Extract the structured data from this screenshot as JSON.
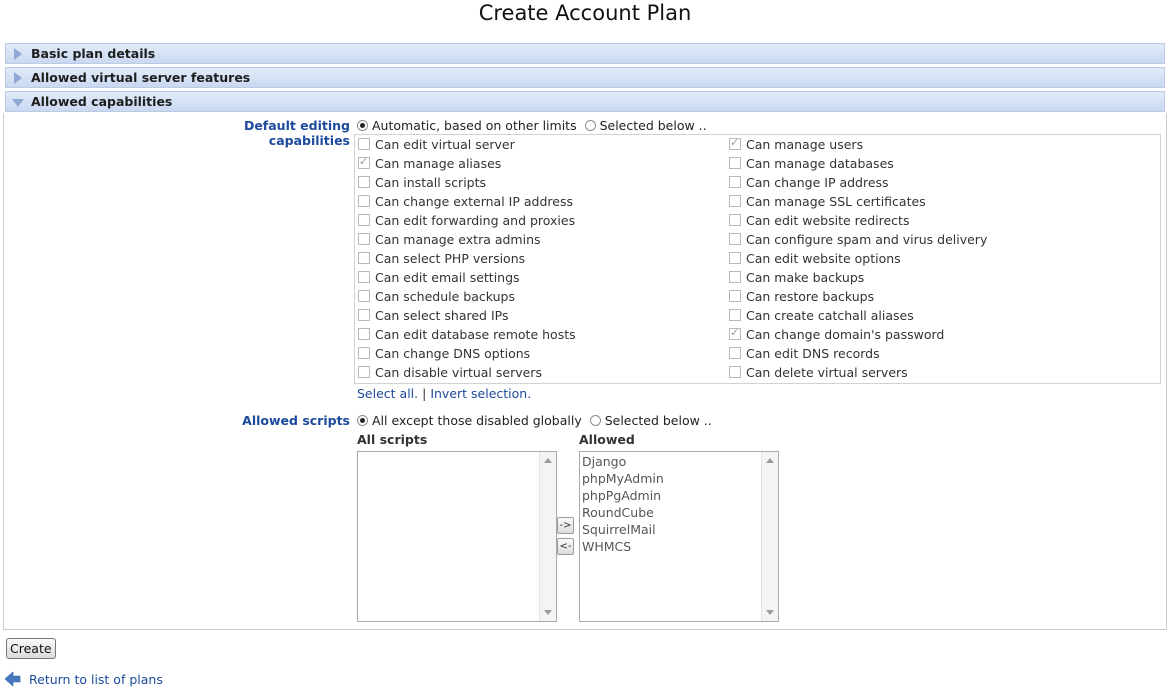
{
  "page": {
    "title": "Create Account Plan"
  },
  "sections": [
    {
      "label": "Basic plan details",
      "expanded": false
    },
    {
      "label": "Allowed virtual server features",
      "expanded": false
    },
    {
      "label": "Allowed capabilities",
      "expanded": true
    }
  ],
  "capabilities": {
    "label": "Default editing capabilities",
    "mode_options": [
      "Automatic, based on other limits",
      "Selected below .."
    ],
    "selected_mode": "Automatic, based on other limits",
    "left": [
      {
        "label": "Can edit virtual server",
        "checked": false
      },
      {
        "label": "Can manage aliases",
        "checked": true
      },
      {
        "label": "Can install scripts",
        "checked": false
      },
      {
        "label": "Can change external IP address",
        "checked": false
      },
      {
        "label": "Can edit forwarding and proxies",
        "checked": false
      },
      {
        "label": "Can manage extra admins",
        "checked": false
      },
      {
        "label": "Can select PHP versions",
        "checked": false
      },
      {
        "label": "Can edit email settings",
        "checked": false
      },
      {
        "label": "Can schedule backups",
        "checked": false
      },
      {
        "label": "Can select shared IPs",
        "checked": false
      },
      {
        "label": "Can edit database remote hosts",
        "checked": false
      },
      {
        "label": "Can change DNS options",
        "checked": false
      },
      {
        "label": "Can disable virtual servers",
        "checked": false
      }
    ],
    "right": [
      {
        "label": "Can manage users",
        "checked": true
      },
      {
        "label": "Can manage databases",
        "checked": false
      },
      {
        "label": "Can change IP address",
        "checked": false
      },
      {
        "label": "Can manage SSL certificates",
        "checked": false
      },
      {
        "label": "Can edit website redirects",
        "checked": false
      },
      {
        "label": "Can configure spam and virus delivery",
        "checked": false
      },
      {
        "label": "Can edit website options",
        "checked": false
      },
      {
        "label": "Can make backups",
        "checked": false
      },
      {
        "label": "Can restore backups",
        "checked": false
      },
      {
        "label": "Can create catchall aliases",
        "checked": false
      },
      {
        "label": "Can change domain's password",
        "checked": true
      },
      {
        "label": "Can edit DNS records",
        "checked": false
      },
      {
        "label": "Can delete virtual servers",
        "checked": false
      }
    ],
    "select_all": "Select all.",
    "separator": "|",
    "invert": "Invert selection."
  },
  "scripts": {
    "label": "Allowed scripts",
    "mode_options": [
      "All except those disabled globally",
      "Selected below .."
    ],
    "selected_mode": "All except those disabled globally",
    "all_header": "All scripts",
    "allowed_header": "Allowed",
    "all": [],
    "allowed": [
      "Django",
      "phpMyAdmin",
      "phpPgAdmin",
      "RoundCube",
      "SquirrelMail",
      "WHMCS"
    ],
    "add_btn": "->",
    "remove_btn": "<-"
  },
  "actions": {
    "create": "Create",
    "back": "Return to list of plans"
  }
}
